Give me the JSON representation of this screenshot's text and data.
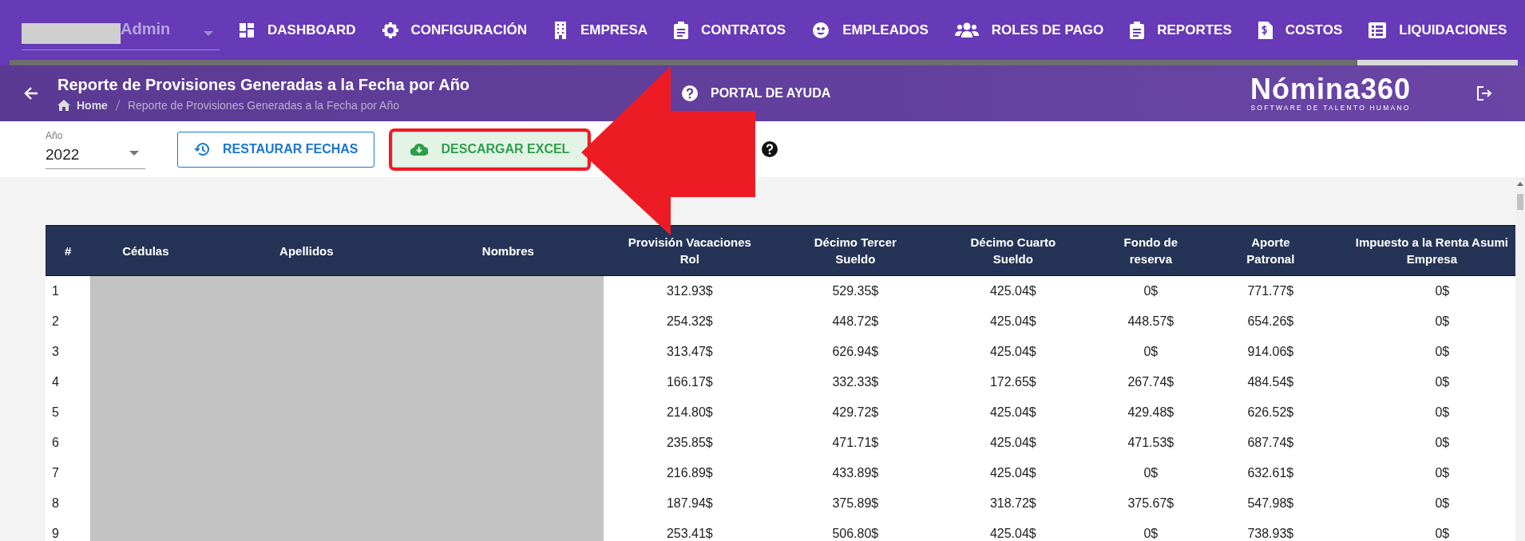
{
  "user_menu": {
    "label": "Admin"
  },
  "nav": [
    {
      "label": "DASHBOARD",
      "selected": false
    },
    {
      "label": "CONFIGURACIÓN",
      "selected": false
    },
    {
      "label": "EMPRESA",
      "selected": false
    },
    {
      "label": "CONTRATOS",
      "selected": false
    },
    {
      "label": "EMPLEADOS",
      "selected": false
    },
    {
      "label": "ROLES DE PAGO",
      "selected": false
    },
    {
      "label": "REPORTES",
      "selected": false
    },
    {
      "label": "COSTOS",
      "selected": false
    },
    {
      "label": "LIQUIDACIONES",
      "selected": true
    }
  ],
  "header": {
    "title": "Reporte de Provisiones Generadas a la Fecha por Año",
    "breadcrumb": [
      "Home",
      "Reporte de Provisiones Generadas a la Fecha por Año"
    ],
    "help_link": "PORTAL DE AYUDA",
    "logo": {
      "name": "Nómina360",
      "tagline": "SOFTWARE DE TALENTO HUMANO"
    }
  },
  "toolbar": {
    "year": {
      "label": "Año",
      "value": "2022"
    },
    "buttons": [
      {
        "label": "RESTAURAR FECHAS",
        "kind": "restore"
      },
      {
        "label": "DESCARGAR EXCEL",
        "kind": "download"
      }
    ]
  },
  "table": {
    "columns": [
      "#",
      "Cédulas",
      "Apellidos",
      "Nombres",
      "Provisión Vacaciones Rol",
      "Décimo Tercer Sueldo",
      "Décimo Cuarto Sueldo",
      "Fondo de reserva",
      "Aporte Patronal",
      "Impuesto a la Renta Asumi Empresa"
    ],
    "rows": [
      [
        "1",
        "",
        "",
        "",
        "312.93$",
        "529.35$",
        "425.04$",
        "0$",
        "771.77$",
        "0$"
      ],
      [
        "2",
        "",
        "",
        "",
        "254.32$",
        "448.72$",
        "425.04$",
        "448.57$",
        "654.26$",
        "0$"
      ],
      [
        "3",
        "",
        "",
        "",
        "313.47$",
        "626.94$",
        "425.04$",
        "0$",
        "914.06$",
        "0$"
      ],
      [
        "4",
        "",
        "",
        "",
        "166.17$",
        "332.33$",
        "172.65$",
        "267.74$",
        "484.54$",
        "0$"
      ],
      [
        "5",
        "",
        "",
        "",
        "214.80$",
        "429.72$",
        "425.04$",
        "429.48$",
        "626.52$",
        "0$"
      ],
      [
        "6",
        "",
        "",
        "",
        "235.85$",
        "471.71$",
        "425.04$",
        "471.53$",
        "687.74$",
        "0$"
      ],
      [
        "7",
        "",
        "",
        "",
        "216.89$",
        "433.89$",
        "425.04$",
        "0$",
        "632.61$",
        "0$"
      ],
      [
        "8",
        "",
        "",
        "",
        "187.94$",
        "375.89$",
        "318.72$",
        "375.67$",
        "547.98$",
        "0$"
      ],
      [
        "9",
        "",
        "",
        "",
        "253.41$",
        "506.80$",
        "425.04$",
        "0$",
        "738.93$",
        "0$"
      ]
    ]
  }
}
